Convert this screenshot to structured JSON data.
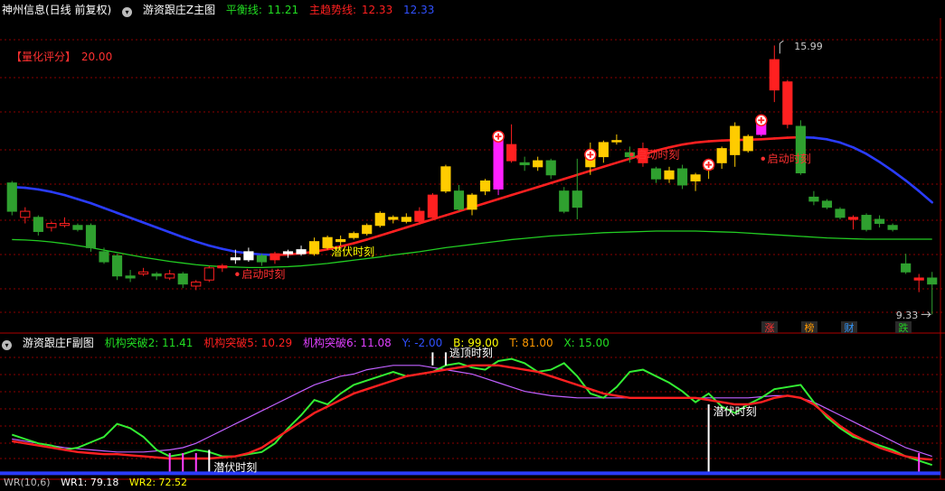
{
  "colors": {
    "up": "#ff2020",
    "down": "#2fa02f",
    "yellow": "#ffcc00",
    "magenta": "#ff20ff",
    "white": "#ffffff",
    "blue": "#2a3cff",
    "green": "#22cc22",
    "red": "#ff2020",
    "grid": "#8b0000",
    "purple": "#c060ff"
  },
  "main_header": {
    "stock": "神州信息(日线 前复权)",
    "indicator": "游资跟庄Z主图",
    "balance_label": "平衡线:",
    "balance_value": "11.21",
    "trend_label": "主趋势线:",
    "trend_value": "12.33",
    "extra_value": "12.33"
  },
  "score": {
    "label": "【量化评分】",
    "value": "20.00"
  },
  "price_labels": {
    "high": "15.99",
    "low": "9.33"
  },
  "annotations": {
    "start": "启动时刻",
    "hide": "潜伏时刻",
    "escape": "逃顶时刻"
  },
  "badges": [
    "涨",
    "榜",
    "财",
    "跌"
  ],
  "sub_header": {
    "title": "游资跟庄F副图",
    "b2": "机构突破2: 11.41",
    "b5": "机构突破5: 10.29",
    "b6": "机构突破6: 11.08",
    "y": "Y: -2.00",
    "b": "B: 99.00",
    "t": "T: 81.00",
    "x": "X: 15.00"
  },
  "bottom_header": {
    "wr": "WR(10,6)",
    "wr1": "WR1: 79.18",
    "wr2": "WR2: 72.52"
  },
  "chart_data": {
    "type": "candlestick",
    "ylim": [
      9.0,
      16.5
    ],
    "candles": [
      [
        12.6,
        11.9,
        12.65,
        11.8
      ],
      [
        11.75,
        11.9,
        12.0,
        11.6
      ],
      [
        11.75,
        11.4,
        11.8,
        11.3
      ],
      [
        11.5,
        11.6,
        11.65,
        11.4
      ],
      [
        11.55,
        11.6,
        11.75,
        11.5
      ],
      [
        11.55,
        11.45,
        11.6,
        11.4
      ],
      [
        11.55,
        11.0,
        11.6,
        10.9
      ],
      [
        10.9,
        10.65,
        11.0,
        10.6
      ],
      [
        10.8,
        10.3,
        10.85,
        10.2
      ],
      [
        10.3,
        10.25,
        10.45,
        10.15
      ],
      [
        10.35,
        10.4,
        10.5,
        10.3
      ],
      [
        10.35,
        10.3,
        10.4,
        10.2
      ],
      [
        10.25,
        10.35,
        10.45,
        10.2
      ],
      [
        10.35,
        10.1,
        10.4,
        10.0
      ],
      [
        10.05,
        10.15,
        10.2,
        9.95
      ],
      [
        10.2,
        10.5,
        10.55,
        10.15
      ],
      [
        10.5,
        10.55,
        10.6,
        10.4
      ],
      [
        10.7,
        10.75,
        10.95,
        10.6
      ],
      [
        10.7,
        10.9,
        11.0,
        10.65
      ],
      [
        10.8,
        10.65,
        10.85,
        10.55
      ],
      [
        10.7,
        10.85,
        10.9,
        10.6
      ],
      [
        10.85,
        10.9,
        10.95,
        10.75
      ],
      [
        10.85,
        10.95,
        11.05,
        10.8
      ],
      [
        10.85,
        11.15,
        11.25,
        10.8
      ],
      [
        11.0,
        11.25,
        11.3,
        10.95
      ],
      [
        11.15,
        11.2,
        11.3,
        11.05
      ],
      [
        11.25,
        11.35,
        11.4,
        11.2
      ],
      [
        11.35,
        11.55,
        11.6,
        11.3
      ],
      [
        11.55,
        11.85,
        11.9,
        11.5
      ],
      [
        11.7,
        11.75,
        11.8,
        11.6
      ],
      [
        11.65,
        11.75,
        11.85,
        11.6
      ],
      [
        11.65,
        11.9,
        12.0,
        11.6
      ],
      [
        11.75,
        12.3,
        12.35,
        11.7
      ],
      [
        12.4,
        13.0,
        13.05,
        12.35
      ],
      [
        12.4,
        11.95,
        12.55,
        11.9
      ],
      [
        11.95,
        12.3,
        12.35,
        11.8
      ],
      [
        12.4,
        12.65,
        12.7,
        12.3
      ],
      [
        12.45,
        13.75,
        13.8,
        12.3
      ],
      [
        13.15,
        13.55,
        14.05,
        13.1
      ],
      [
        13.1,
        13.05,
        13.25,
        12.9
      ],
      [
        13.0,
        13.15,
        13.25,
        12.9
      ],
      [
        13.15,
        12.8,
        13.2,
        12.7
      ],
      [
        12.4,
        11.9,
        12.5,
        11.85
      ],
      [
        12.4,
        12.0,
        13.2,
        11.7
      ],
      [
        13.0,
        13.3,
        13.6,
        12.8
      ],
      [
        13.25,
        13.6,
        13.65,
        13.1
      ],
      [
        13.65,
        13.65,
        13.8,
        13.55
      ],
      [
        13.35,
        13.25,
        13.5,
        13.1
      ],
      [
        13.1,
        13.45,
        13.6,
        13.0
      ],
      [
        12.95,
        12.7,
        13.0,
        12.6
      ],
      [
        12.7,
        12.9,
        13.0,
        12.6
      ],
      [
        12.95,
        12.55,
        13.05,
        12.45
      ],
      [
        12.65,
        12.8,
        12.85,
        12.4
      ],
      [
        12.95,
        13.05,
        13.2,
        12.7
      ],
      [
        13.1,
        13.45,
        13.5,
        12.95
      ],
      [
        13.3,
        14.0,
        14.1,
        13.0
      ],
      [
        13.4,
        13.75,
        13.8,
        13.35
      ],
      [
        13.8,
        14.15,
        14.3,
        13.75
      ],
      [
        14.9,
        15.65,
        16.0,
        14.6
      ],
      [
        14.05,
        15.1,
        15.15,
        13.95
      ],
      [
        14.0,
        12.85,
        14.15,
        12.8
      ],
      [
        12.25,
        12.15,
        12.4,
        12.05
      ],
      [
        12.15,
        12.0,
        12.2,
        11.95
      ],
      [
        11.95,
        11.75,
        12.0,
        11.7
      ],
      [
        11.7,
        11.75,
        11.8,
        11.45
      ],
      [
        11.8,
        11.45,
        11.85,
        11.4
      ],
      [
        11.7,
        11.6,
        11.8,
        11.5
      ],
      [
        11.55,
        11.45,
        11.6,
        11.4
      ],
      [
        10.6,
        10.4,
        10.85,
        10.35
      ],
      [
        10.2,
        10.25,
        10.35,
        9.9
      ],
      [
        10.25,
        10.1,
        10.4,
        9.35
      ]
    ],
    "highlight_magenta": [
      37,
      57
    ],
    "highlight_yellow": [
      23,
      24,
      25,
      26,
      27,
      28,
      29,
      30,
      33,
      34,
      35,
      36,
      39,
      40,
      43,
      44,
      45,
      46,
      47,
      50,
      51,
      52,
      53,
      54,
      55,
      56
    ],
    "balance_line": [
      11.2,
      11.19,
      11.17,
      11.14,
      11.1,
      11.05,
      11.0,
      10.94,
      10.88,
      10.82,
      10.76,
      10.71,
      10.66,
      10.62,
      10.58,
      10.55,
      10.53,
      10.52,
      10.51,
      10.51,
      10.52,
      10.53,
      10.55,
      10.58,
      10.61,
      10.65,
      10.69,
      10.73,
      10.77,
      10.82,
      10.86,
      10.9,
      10.95,
      11.0,
      11.04,
      11.08,
      11.12,
      11.16,
      11.2,
      11.23,
      11.26,
      11.29,
      11.31,
      11.33,
      11.35,
      11.37,
      11.38,
      11.39,
      11.4,
      11.41,
      11.41,
      11.41,
      11.41,
      11.4,
      11.39,
      11.38,
      11.36,
      11.34,
      11.32,
      11.3,
      11.28,
      11.26,
      11.24,
      11.23,
      11.22,
      11.21,
      11.21,
      11.21,
      11.21,
      11.21,
      11.21
    ],
    "trend_line": [
      12.5,
      12.48,
      12.44,
      12.38,
      12.3,
      12.2,
      12.1,
      11.98,
      11.86,
      11.74,
      11.62,
      11.5,
      11.38,
      11.26,
      11.15,
      11.05,
      10.97,
      10.9,
      10.86,
      10.83,
      10.82,
      10.83,
      10.86,
      10.9,
      10.96,
      11.03,
      11.11,
      11.2,
      11.3,
      11.4,
      11.5,
      11.6,
      11.7,
      11.8,
      11.9,
      12.0,
      12.1,
      12.2,
      12.3,
      12.4,
      12.5,
      12.6,
      12.7,
      12.8,
      12.9,
      13.0,
      13.1,
      13.2,
      13.3,
      13.4,
      13.48,
      13.55,
      13.6,
      13.63,
      13.65,
      13.66,
      13.67,
      13.68,
      13.7,
      13.72,
      13.73,
      13.72,
      13.68,
      13.6,
      13.48,
      13.32,
      13.12,
      12.9,
      12.66,
      12.4,
      12.12
    ],
    "start_markers": [
      17,
      47,
      57
    ],
    "hide_markers": [
      24
    ],
    "sub": {
      "ylim": [
        -5,
        110
      ],
      "green": [
        32,
        28,
        24,
        22,
        18,
        20,
        25,
        30,
        42,
        38,
        30,
        18,
        12,
        14,
        18,
        16,
        12,
        12,
        14,
        16,
        24,
        38,
        50,
        64,
        60,
        70,
        78,
        82,
        86,
        90,
        86,
        88,
        90,
        96,
        98,
        94,
        92,
        100,
        102,
        98,
        90,
        92,
        98,
        86,
        70,
        66,
        76,
        90,
        92,
        86,
        80,
        72,
        62,
        70,
        58,
        52,
        60,
        66,
        74,
        76,
        78,
        62,
        48,
        38,
        30,
        26,
        22,
        18,
        12,
        8,
        4
      ],
      "red": [
        26,
        24,
        22,
        20,
        18,
        16,
        15,
        14,
        14,
        13,
        12,
        11,
        10,
        10,
        10,
        10,
        11,
        12,
        15,
        20,
        28,
        36,
        44,
        52,
        58,
        64,
        70,
        74,
        78,
        82,
        86,
        88,
        90,
        92,
        94,
        96,
        96,
        96,
        94,
        92,
        90,
        86,
        82,
        78,
        74,
        70,
        68,
        66,
        66,
        66,
        66,
        66,
        66,
        64,
        62,
        60,
        60,
        62,
        66,
        68,
        66,
        60,
        50,
        40,
        32,
        26,
        20,
        16,
        12,
        10,
        9
      ],
      "purple": [
        28,
        26,
        24,
        22,
        20,
        19,
        18,
        17,
        16,
        16,
        16,
        17,
        18,
        20,
        24,
        30,
        36,
        42,
        48,
        54,
        60,
        66,
        72,
        78,
        82,
        86,
        88,
        92,
        94,
        96,
        96,
        96,
        94,
        92,
        90,
        88,
        84,
        80,
        76,
        72,
        70,
        68,
        67,
        66,
        66,
        66,
        66,
        66,
        66,
        66,
        66,
        66,
        66,
        66,
        66,
        66,
        66,
        67,
        68,
        68,
        66,
        62,
        56,
        50,
        44,
        38,
        32,
        26,
        20,
        16,
        12
      ],
      "pink_bars": [
        12,
        13,
        14,
        69
      ],
      "white_bars": [
        15,
        53
      ],
      "escape_bar": [
        32,
        33
      ]
    }
  }
}
